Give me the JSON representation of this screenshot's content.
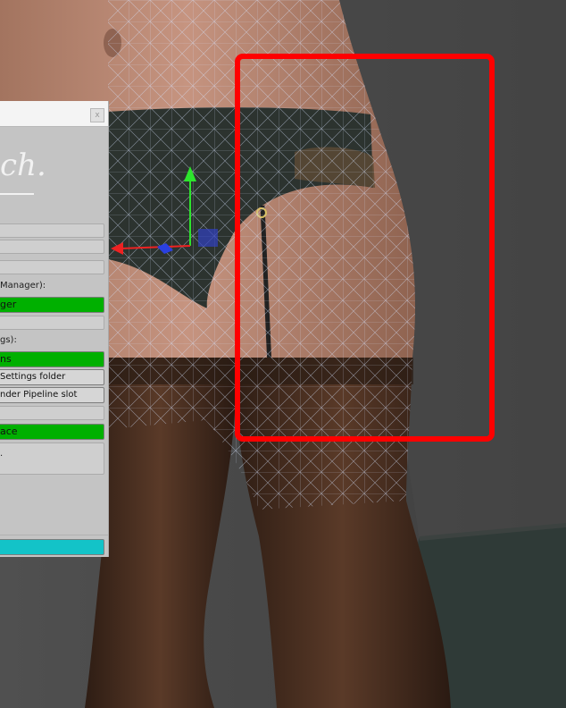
{
  "panel": {
    "close_label": "x",
    "logo_text": "ch.",
    "label_manager": "Manager):",
    "label_settings": "gs):",
    "truncated_suffix": ".",
    "buttons": {
      "manager": "ger",
      "settings": "ns",
      "settings_folder": "Settings folder",
      "render_pipeline_slot": "nder Pipeline slot",
      "replace": "ace",
      "bottom_action": ""
    },
    "colors": {
      "action_button": "#00b000",
      "bottom_button": "#13c3c8"
    }
  },
  "viewport": {
    "selection_color": "#ff0000",
    "wireframe_color": "#c8dcff",
    "gizmo_axes": [
      "x-arrow-red",
      "y-arrow-green",
      "z-square-blue"
    ]
  }
}
